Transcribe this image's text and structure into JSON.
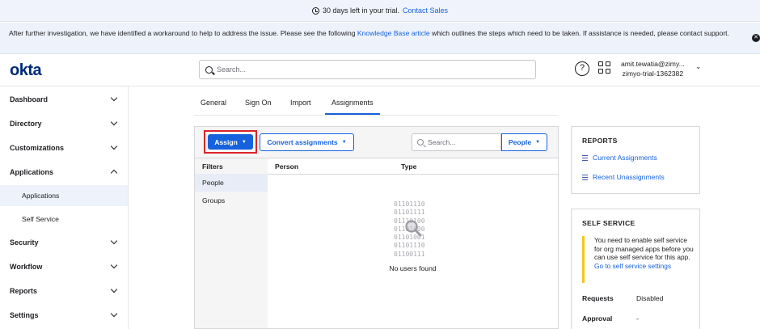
{
  "trial_banner": {
    "text": "30 days left in your trial.",
    "link": "Contact Sales"
  },
  "notice": {
    "text_before": "After further investigation, we have identified a workaround to help to address the issue. Please see the following ",
    "link": "Knowledge Base article",
    "text_after": " which outlines the steps which need to be taken. If assistance is needed, please contact support."
  },
  "header": {
    "logo": "okta",
    "search_placeholder": "Search...",
    "help_glyph": "?",
    "user_email": "amit.tewatia@zimy...",
    "org_name": "zimyo-trial-1362382"
  },
  "sidebar": {
    "items": [
      {
        "label": "Dashboard"
      },
      {
        "label": "Directory"
      },
      {
        "label": "Customizations"
      },
      {
        "label": "Applications",
        "expanded": true
      },
      {
        "label": "Security"
      },
      {
        "label": "Workflow"
      },
      {
        "label": "Reports"
      },
      {
        "label": "Settings"
      }
    ],
    "sub_items": [
      {
        "label": "Applications",
        "active": true
      },
      {
        "label": "Self Service"
      }
    ]
  },
  "tabs": [
    {
      "label": "General"
    },
    {
      "label": "Sign On"
    },
    {
      "label": "Import"
    },
    {
      "label": "Assignments",
      "active": true
    }
  ],
  "toolbar": {
    "assign_label": "Assign",
    "convert_label": "Convert assignments",
    "search_placeholder": "Search...",
    "people_label": "People",
    "caret": "▼"
  },
  "filters": {
    "title": "Filters",
    "items": [
      "People",
      "Groups"
    ],
    "active": "People"
  },
  "grid": {
    "columns": [
      "Person",
      "Type"
    ],
    "empty_binary": "01101110\n01101111\n01110100\n01101000\n01101001\n01101110\n01100111",
    "empty_text": "No users found"
  },
  "reports_card": {
    "title": "REPORTS",
    "links": [
      "Current Assignments",
      "Recent Unassignments"
    ]
  },
  "self_service_card": {
    "title": "SELF SERVICE",
    "note": "You need to enable self service for org managed apps before you can use self service for this app.",
    "note_link": "Go to self service settings",
    "rows": [
      {
        "key": "Requests",
        "value": "Disabled"
      },
      {
        "key": "Approval",
        "value": "-"
      }
    ]
  },
  "colors": {
    "accent": "#1662dd",
    "logo": "#00297a",
    "highlight_border": "#d9242b",
    "note_bar": "#f5c518"
  }
}
